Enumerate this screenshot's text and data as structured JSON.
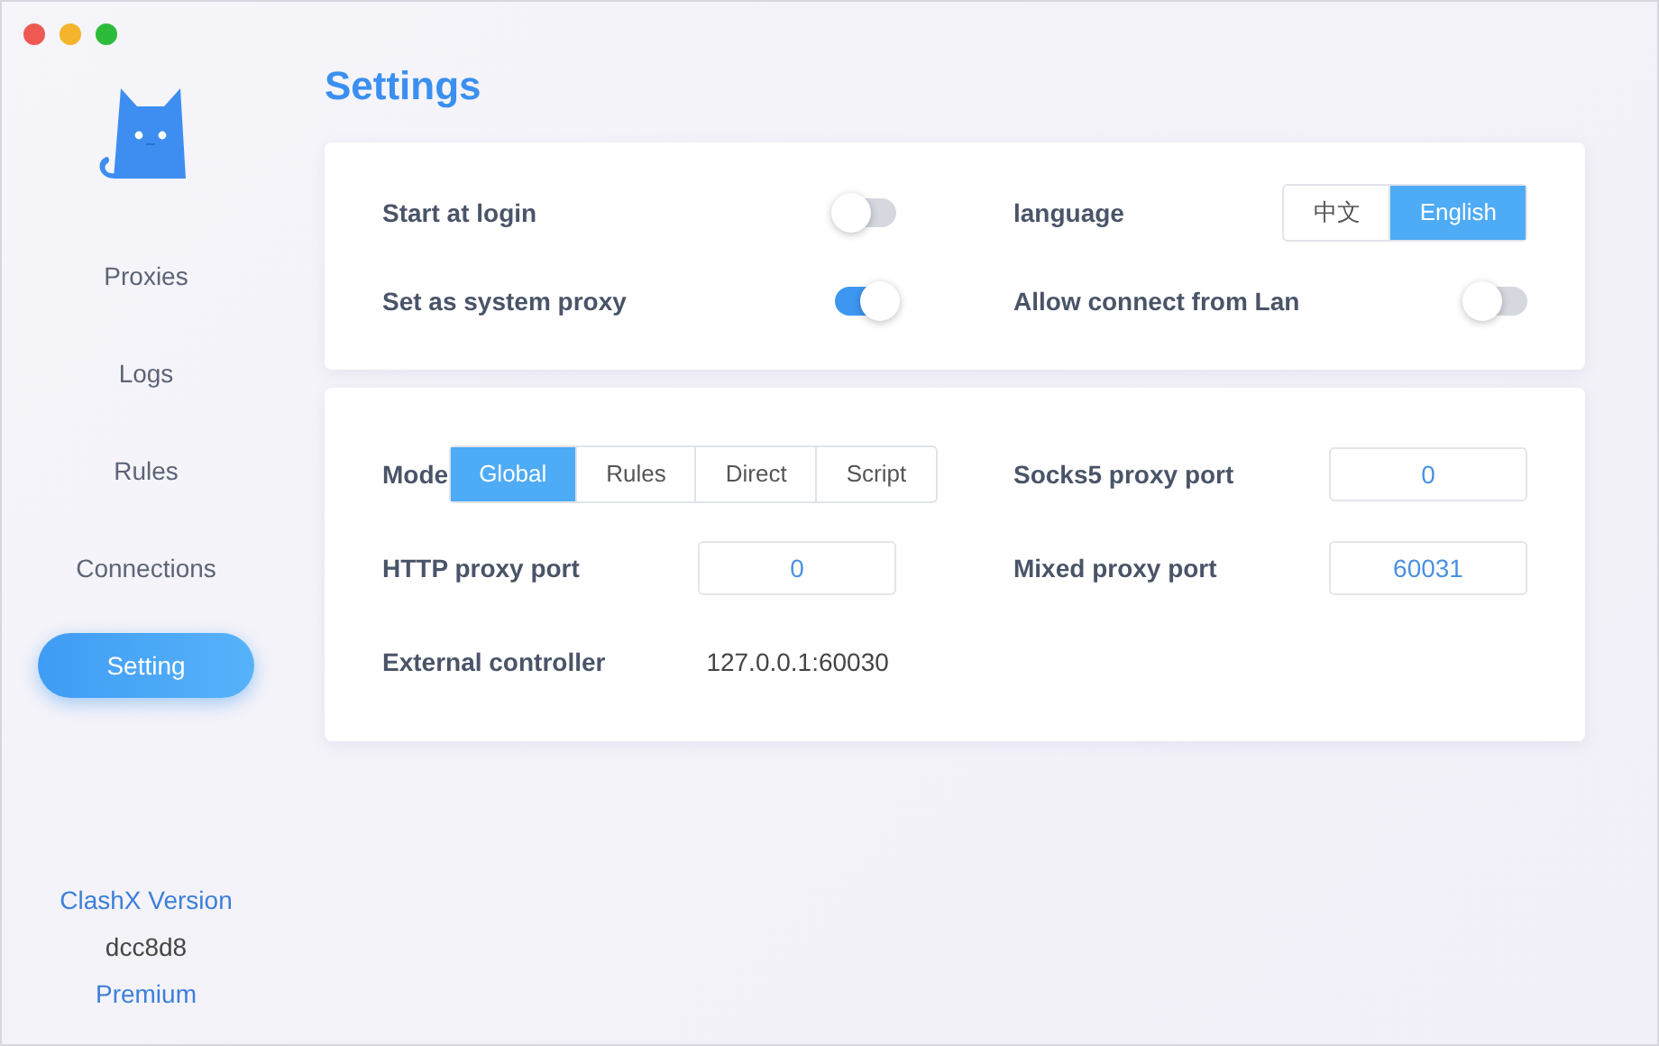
{
  "window": {
    "title": "Settings"
  },
  "sidebar": {
    "items": [
      {
        "label": "Proxies",
        "selected": false
      },
      {
        "label": "Logs",
        "selected": false
      },
      {
        "label": "Rules",
        "selected": false
      },
      {
        "label": "Connections",
        "selected": false
      },
      {
        "label": "Setting",
        "selected": true
      }
    ],
    "footer": {
      "version_link": "ClashX Version",
      "version": "dcc8d8",
      "premium_link": "Premium"
    }
  },
  "cards": [
    {
      "items": [
        {
          "kind": "toggle",
          "label": "Start at login",
          "on": false
        },
        {
          "kind": "segmented",
          "label": "language",
          "options": [
            {
              "label": "中文",
              "selected": false
            },
            {
              "label": "English",
              "selected": true
            }
          ]
        },
        {
          "kind": "toggle",
          "label": "Set as system proxy",
          "on": true
        },
        {
          "kind": "toggle",
          "label": "Allow connect from Lan",
          "on": false
        }
      ]
    },
    {
      "items": [
        {
          "kind": "segmented",
          "label": "Mode",
          "options": [
            {
              "label": "Global",
              "selected": true
            },
            {
              "label": "Rules",
              "selected": false
            },
            {
              "label": "Direct",
              "selected": false
            },
            {
              "label": "Script",
              "selected": false
            }
          ]
        },
        {
          "kind": "field",
          "label": "Socks5 proxy port",
          "value": "0"
        },
        {
          "kind": "field",
          "label": "HTTP proxy port",
          "value": "0"
        },
        {
          "kind": "field",
          "label": "Mixed proxy port",
          "value": "60031"
        },
        {
          "kind": "text",
          "label": "External controller",
          "value": "127.0.0.1:60030"
        }
      ]
    }
  ]
}
